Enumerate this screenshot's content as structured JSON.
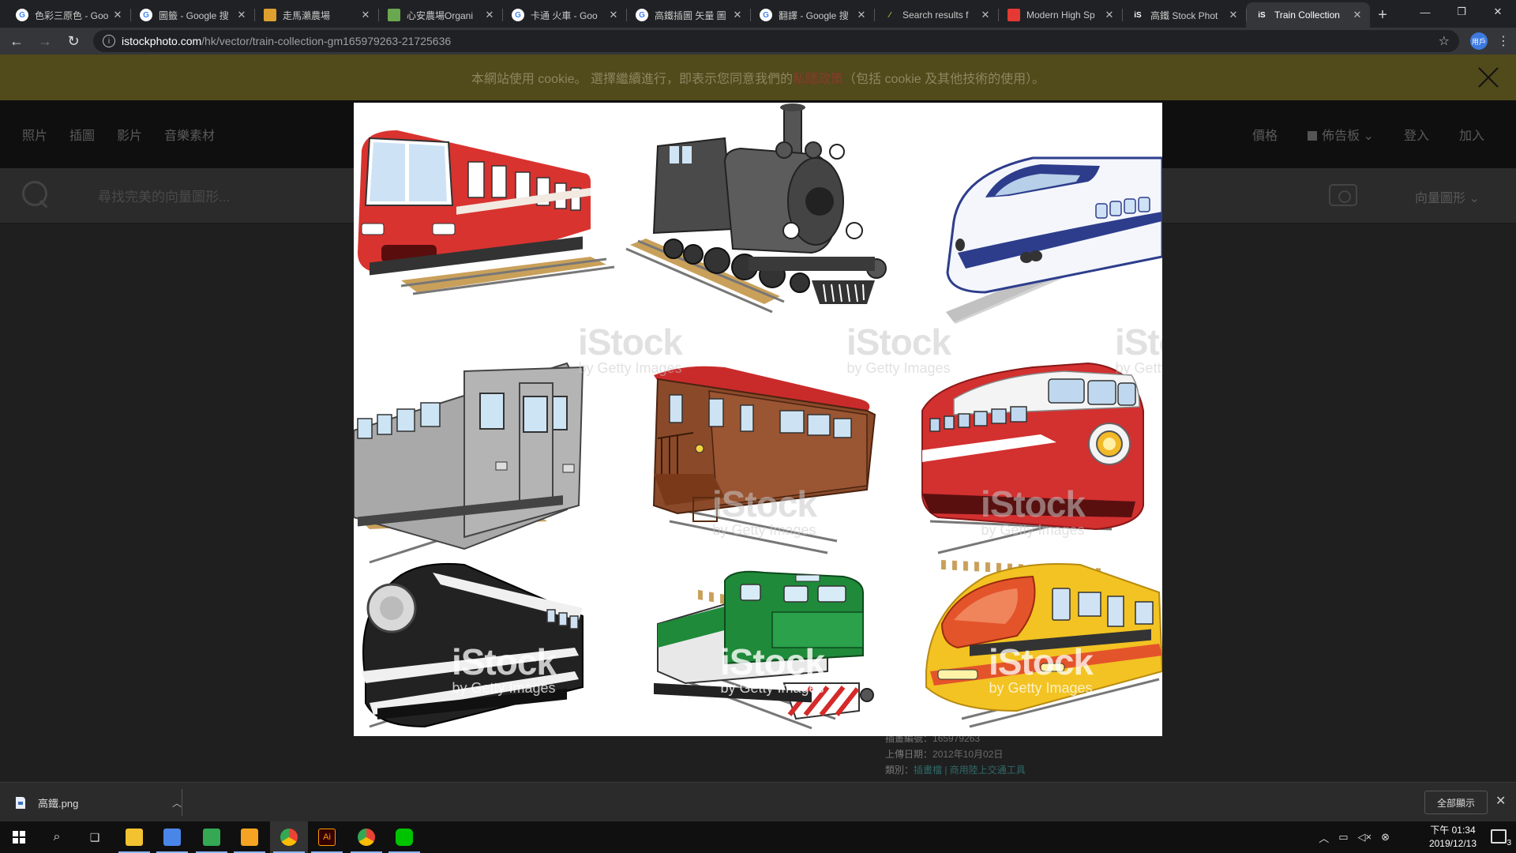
{
  "browser": {
    "tabs": [
      {
        "title": "色彩三原色 - Goo",
        "icon": "google",
        "color": "#ffffff"
      },
      {
        "title": "圖籤 - Google 搜",
        "icon": "google",
        "color": "#ffffff"
      },
      {
        "title": "走馬瀨農場",
        "icon": "site",
        "color": "#e0a030"
      },
      {
        "title": "心安農場Organi",
        "icon": "site",
        "color": "#6aa84f"
      },
      {
        "title": "卡通 火車 - Goo",
        "icon": "google",
        "color": "#ffffff"
      },
      {
        "title": "高鐵插圖 矢量 圖",
        "icon": "google",
        "color": "#ffffff"
      },
      {
        "title": "翻譯 - Google 搜",
        "icon": "google",
        "color": "#ffffff"
      },
      {
        "title": "Search results f",
        "icon": "feather",
        "color": "#9acd32"
      },
      {
        "title": "Modern High Sp",
        "icon": "pdf",
        "color": "#e53935"
      },
      {
        "title": "高鐵 Stock Phot",
        "icon": "istock",
        "color": "#ffffff"
      },
      {
        "title": "Train Collection",
        "icon": "istock",
        "color": "#ffffff",
        "active": true
      }
    ],
    "url_domain": "istockphoto.com",
    "url_path": "/hk/vector/train-collection-gm165979263-21725636",
    "profile_label": "用戶"
  },
  "cookie": {
    "text_before": "本網站使用 cookie。 選擇繼續進行，即表示您同意我們的",
    "link": "私隱政策",
    "text_after": "（包括 cookie 及其他技術的使用）。"
  },
  "sitenav": {
    "links": [
      "照片",
      "插圖",
      "影片",
      "音樂素材"
    ],
    "right": {
      "pricing": "價格",
      "board": "佈告板",
      "login": "登入",
      "join": "加入"
    }
  },
  "search": {
    "placeholder": "尋找完美的向量圖形...",
    "filter": "向量圖形"
  },
  "details": {
    "id_label": "插畫編號：",
    "id_value": "165979263",
    "date_label": "上傳日期：",
    "date_value": "2012年10月02日",
    "category_label": "類別：",
    "categories": "插畫檔 | 商用陸上交通工具"
  },
  "watermark": {
    "brand": "iStock",
    "sub": "by Getty Images"
  },
  "trains": [
    {
      "name": "red-commuter-train",
      "body": "#d9332f"
    },
    {
      "name": "steam-locomotive",
      "body": "#555555"
    },
    {
      "name": "bullet-train",
      "body": "#f4f6fb",
      "accent": "#2d3d8c"
    },
    {
      "name": "silver-subway-car",
      "body": "#a9a9a9"
    },
    {
      "name": "wooden-caboose",
      "body": "#8a4a2a"
    },
    {
      "name": "red-streamliner",
      "body": "#d33030"
    },
    {
      "name": "black-streamline-locomotive",
      "body": "#222222"
    },
    {
      "name": "green-diesel-locomotive",
      "body": "#1f8a3a"
    },
    {
      "name": "yellow-express-train",
      "body": "#f2c322",
      "accent": "#e4542b"
    }
  ],
  "download": {
    "filename": "高鐵.png",
    "show_all": "全部顯示"
  },
  "taskbar": {
    "time": "下午 01:34",
    "date": "2019/12/13",
    "notifications": "3"
  }
}
